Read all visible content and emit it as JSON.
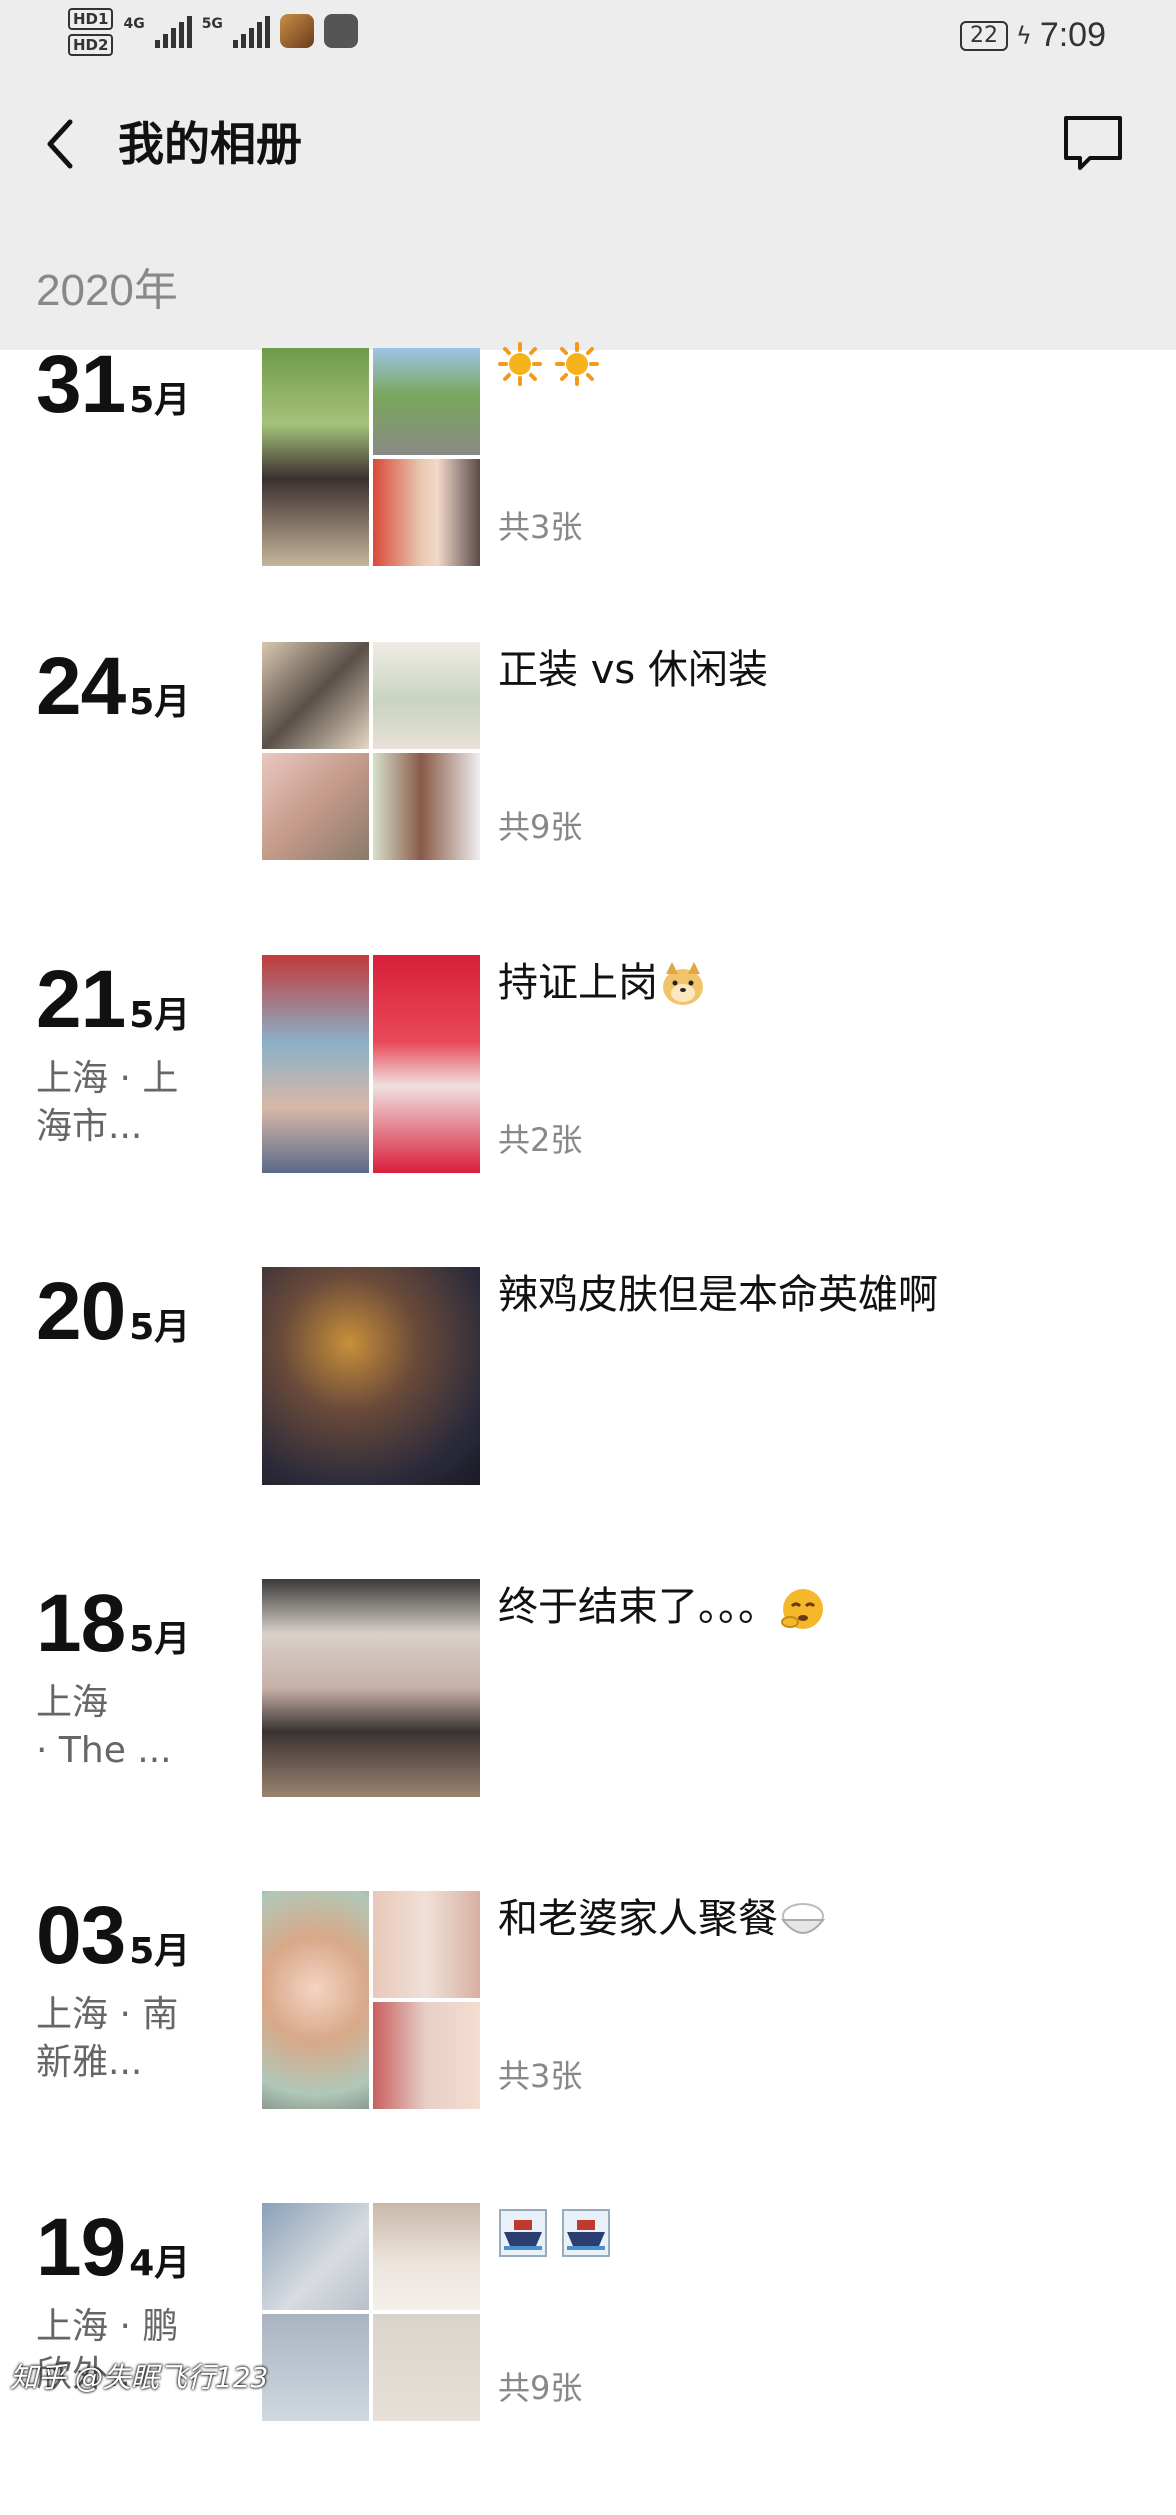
{
  "status_bar": {
    "hd1": "HD1",
    "hd2": "HD2",
    "net1": "4G",
    "net2": "5G",
    "battery": "22",
    "time": "7:09"
  },
  "nav": {
    "title": "我的相册",
    "back_icon": "chevron-left-icon",
    "message_icon": "chat-bubble-icon"
  },
  "year_header": "2020年",
  "entries": [
    {
      "day": "31",
      "month": "5月",
      "location": "",
      "caption": "",
      "caption_emoji": [
        "sun",
        "sun"
      ],
      "count": "共3张"
    },
    {
      "day": "24",
      "month": "5月",
      "location": "",
      "caption": "正装 vs 休闲装",
      "count": "共9张"
    },
    {
      "day": "21",
      "month": "5月",
      "location": "上海 · 上\n海市...",
      "caption": "持证上岗",
      "caption_emoji": [
        "doge"
      ],
      "count": "共2张"
    },
    {
      "day": "20",
      "month": "5月",
      "location": "",
      "caption": "辣鸡皮肤但是本命英雄啊",
      "count": ""
    },
    {
      "day": "18",
      "month": "5月",
      "location": "上海\n· The ...",
      "caption": "终于结束了。。。",
      "caption_emoji": [
        "huff"
      ],
      "count": ""
    },
    {
      "day": "03",
      "month": "5月",
      "location": "上海 · 南\n新雅...",
      "caption": "和老婆家人聚餐",
      "caption_emoji": [
        "rice"
      ],
      "count": "共3张"
    },
    {
      "day": "19",
      "month": "4月",
      "location": "上海 · 鹏\n欣外...",
      "caption": "",
      "caption_emoji": [
        "ship",
        "ship"
      ],
      "count": "共9张"
    }
  ],
  "watermark": "知乎 @失眠飞行123",
  "colors": {
    "bar_bg": "#ededed",
    "text": "#111111",
    "muted": "#888888",
    "loc": "#666666"
  }
}
